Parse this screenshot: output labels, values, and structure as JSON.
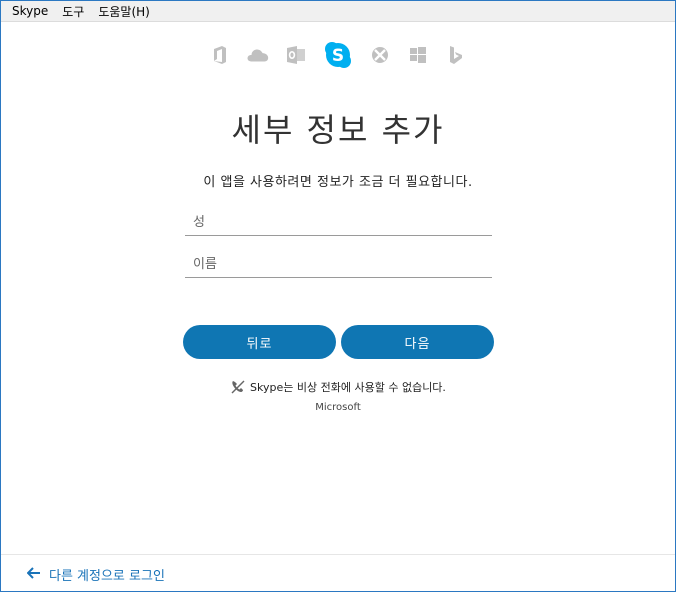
{
  "menu": [
    "Skype",
    "도구",
    "도움말(H)"
  ],
  "product_icons": [
    {
      "name": "office-icon",
      "color": "#c0c0c0"
    },
    {
      "name": "onedrive-icon",
      "color": "#c0c0c0"
    },
    {
      "name": "outlook-icon",
      "color": "#c0c0c0"
    },
    {
      "name": "skype-icon",
      "color": "#00aff0"
    },
    {
      "name": "xbox-icon",
      "color": "#c0c0c0"
    },
    {
      "name": "windows-icon",
      "color": "#c0c0c0"
    },
    {
      "name": "bing-icon",
      "color": "#c0c0c0"
    }
  ],
  "title": "세부 정보 추가",
  "subtitle": "이 앱을 사용하려면 정보가 조금 더 필요합니다.",
  "form": {
    "last_name_placeholder": "성",
    "first_name_placeholder": "이름",
    "last_name_value": "",
    "first_name_value": ""
  },
  "buttons": {
    "back": "뒤로",
    "next": "다음"
  },
  "notice": "Skype는 비상 전화에 사용할 수 없습니다.",
  "brand": "Microsoft",
  "footer_link": "다른 계정으로 로그인",
  "colors": {
    "accent": "#0f76b3",
    "link": "#1a73b8",
    "skype": "#00aff0",
    "icon_gray": "#c0c0c0",
    "window_border": "#2b78c2"
  }
}
